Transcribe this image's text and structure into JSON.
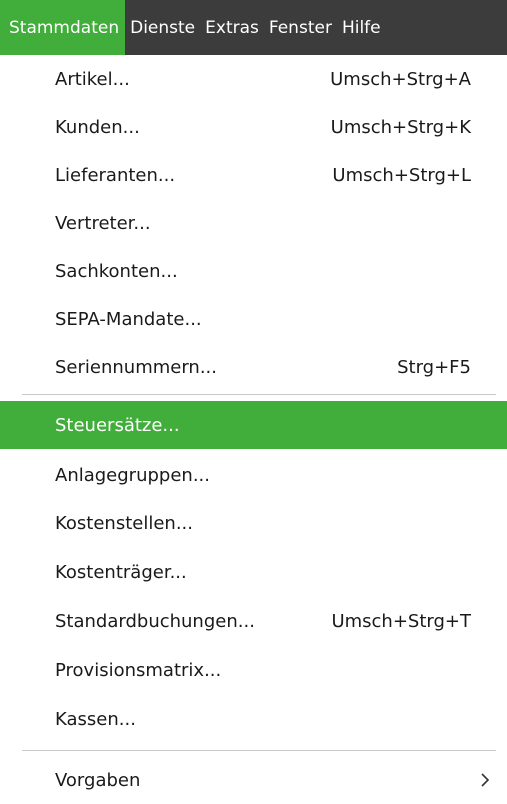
{
  "menubar": {
    "items": [
      {
        "label": "Stammdaten"
      },
      {
        "label": "Dienste"
      },
      {
        "label": "Extras"
      },
      {
        "label": "Fenster"
      },
      {
        "label": "Hilfe"
      }
    ]
  },
  "menu": {
    "items": [
      {
        "label": "Artikel...",
        "shortcut": "Umsch+Strg+A"
      },
      {
        "label": "Kunden...",
        "shortcut": "Umsch+Strg+K"
      },
      {
        "label": "Lieferanten...",
        "shortcut": "Umsch+Strg+L"
      },
      {
        "label": "Vertreter...",
        "shortcut": ""
      },
      {
        "label": "Sachkonten...",
        "shortcut": ""
      },
      {
        "label": "SEPA-Mandate...",
        "shortcut": ""
      },
      {
        "label": "Seriennummern...",
        "shortcut": "Strg+F5"
      },
      {
        "label": "Steuersätze...",
        "shortcut": ""
      },
      {
        "label": "Anlagegruppen...",
        "shortcut": ""
      },
      {
        "label": "Kostenstellen...",
        "shortcut": ""
      },
      {
        "label": "Kostenträger...",
        "shortcut": ""
      },
      {
        "label": "Standardbuchungen...",
        "shortcut": "Umsch+Strg+T"
      },
      {
        "label": "Provisionsmatrix...",
        "shortcut": ""
      },
      {
        "label": "Kassen...",
        "shortcut": ""
      },
      {
        "label": "Vorgaben",
        "shortcut": ""
      }
    ]
  },
  "colors": {
    "accent": "#41ad3a",
    "menubar_bg": "#3c3c3c"
  },
  "icons": {
    "submenu": "chevron-right-icon"
  }
}
